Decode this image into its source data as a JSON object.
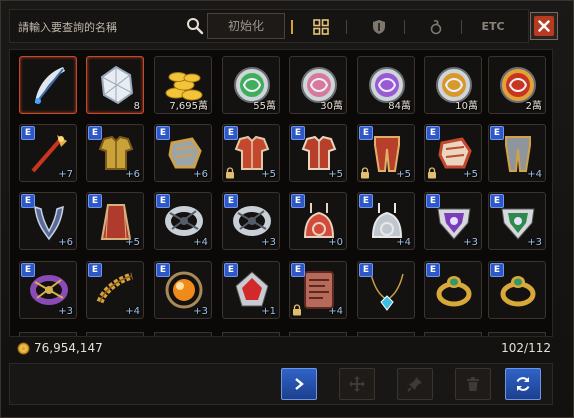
{
  "search": {
    "placeholder": "請輸入要查詢的名稱"
  },
  "toolbar": {
    "init_label": "初始化"
  },
  "tabs": [
    {
      "id": "all",
      "icon": "grid-icon",
      "active": true
    },
    {
      "id": "equip",
      "icon": "shield-icon",
      "active": false
    },
    {
      "id": "consumable",
      "icon": "potion-icon",
      "active": false
    },
    {
      "id": "etc",
      "label": "ETC",
      "active": false
    }
  ],
  "inventory": {
    "gold": "76,954,147",
    "capacity": "102/112",
    "slots": [
      {
        "name": "feather-quill",
        "qty": "",
        "enh": "",
        "e": false,
        "lock": false,
        "selected": true,
        "art": "feather",
        "c1": "#dfe6ee",
        "c2": "#3a6fb0"
      },
      {
        "name": "crystal-gem",
        "qty": "8",
        "enh": "",
        "e": false,
        "lock": false,
        "selected": true,
        "art": "crystal",
        "c1": "#e8edf4",
        "c2": "#9aa7b8"
      },
      {
        "name": "gold-coins",
        "qty": "7,695萬",
        "enh": "",
        "e": false,
        "lock": false,
        "selected": false,
        "art": "coins",
        "c1": "#f3c43a",
        "c2": "#a77a12"
      },
      {
        "name": "green-medal",
        "qty": "55萬",
        "enh": "",
        "e": false,
        "lock": false,
        "selected": false,
        "art": "medal",
        "c1": "#3fae5a",
        "c2": "#cfd6da"
      },
      {
        "name": "pink-medal",
        "qty": "30萬",
        "enh": "",
        "e": false,
        "lock": false,
        "selected": false,
        "art": "medal",
        "c1": "#d77a9a",
        "c2": "#cfd6da"
      },
      {
        "name": "purple-medal",
        "qty": "84萬",
        "enh": "",
        "e": false,
        "lock": false,
        "selected": false,
        "art": "medal",
        "c1": "#9a5ad6",
        "c2": "#cfd6da"
      },
      {
        "name": "gold-medal",
        "qty": "10萬",
        "enh": "",
        "e": false,
        "lock": false,
        "selected": false,
        "art": "medal",
        "c1": "#d79a2a",
        "c2": "#cfd6da"
      },
      {
        "name": "red-medal",
        "qty": "2萬",
        "enh": "",
        "e": false,
        "lock": false,
        "selected": false,
        "art": "medal",
        "c1": "#c8361e",
        "c2": "#e2a23a"
      },
      {
        "name": "red-staff",
        "qty": "",
        "enh": "+7",
        "e": true,
        "lock": false,
        "selected": false,
        "art": "staff",
        "c1": "#c8361e",
        "c2": "#e6b04a"
      },
      {
        "name": "gold-armor",
        "qty": "",
        "enh": "+6",
        "e": true,
        "lock": false,
        "selected": false,
        "art": "armor",
        "c1": "#caa23a",
        "c2": "#7a5a1a"
      },
      {
        "name": "gold-gauntlet",
        "qty": "",
        "enh": "+6",
        "e": true,
        "lock": false,
        "selected": false,
        "art": "gauntlet",
        "c1": "#cfa04a",
        "c2": "#9aa4ae"
      },
      {
        "name": "red-pauldron",
        "qty": "",
        "enh": "+5",
        "e": true,
        "lock": true,
        "selected": false,
        "art": "armor",
        "c1": "#c4482e",
        "c2": "#e0c9a8"
      },
      {
        "name": "red-chest",
        "qty": "",
        "enh": "+5",
        "e": true,
        "lock": false,
        "selected": false,
        "art": "armor",
        "c1": "#b8402a",
        "c2": "#e8d6c0"
      },
      {
        "name": "red-leggings",
        "qty": "",
        "enh": "+5",
        "e": true,
        "lock": true,
        "selected": false,
        "art": "legs",
        "c1": "#b8402a",
        "c2": "#e0b06a"
      },
      {
        "name": "red-glove",
        "qty": "",
        "enh": "+5",
        "e": true,
        "lock": true,
        "selected": false,
        "art": "gauntlet",
        "c1": "#c4482e",
        "c2": "#e8d6c0"
      },
      {
        "name": "silver-pants",
        "qty": "",
        "enh": "+4",
        "e": true,
        "lock": false,
        "selected": false,
        "art": "legs",
        "c1": "#8f959c",
        "c2": "#d0a24a"
      },
      {
        "name": "dark-necklace",
        "qty": "",
        "enh": "+6",
        "e": true,
        "lock": false,
        "selected": false,
        "art": "neck",
        "c1": "#5a6a9a",
        "c2": "#c8d0e0"
      },
      {
        "name": "red-cape",
        "qty": "",
        "enh": "+5",
        "e": true,
        "lock": false,
        "selected": false,
        "art": "cape",
        "c1": "#b03a2e",
        "c2": "#d8b07a"
      },
      {
        "name": "silver-bracer-a",
        "qty": "",
        "enh": "+4",
        "e": true,
        "lock": false,
        "selected": false,
        "art": "bracer",
        "c1": "#c9cfd6",
        "c2": "#555c66"
      },
      {
        "name": "silver-bracer-b",
        "qty": "",
        "enh": "+3",
        "e": true,
        "lock": false,
        "selected": false,
        "art": "bracer",
        "c1": "#c9cfd6",
        "c2": "#555c66"
      },
      {
        "name": "red-earring",
        "qty": "",
        "enh": "+0",
        "e": true,
        "lock": false,
        "selected": false,
        "art": "earring",
        "c1": "#d24a3a",
        "c2": "#e8d2c0"
      },
      {
        "name": "silver-earring",
        "qty": "",
        "enh": "+4",
        "e": true,
        "lock": false,
        "selected": false,
        "art": "earring",
        "c1": "#bfc6ce",
        "c2": "#e8e8e8"
      },
      {
        "name": "purple-amulet",
        "qty": "",
        "enh": "+3",
        "e": true,
        "lock": false,
        "selected": false,
        "art": "amulet",
        "c1": "#7a3fb8",
        "c2": "#d6d8de"
      },
      {
        "name": "green-amulet",
        "qty": "",
        "enh": "+3",
        "e": true,
        "lock": false,
        "selected": false,
        "art": "amulet",
        "c1": "#2e8a4a",
        "c2": "#d6d8de"
      },
      {
        "name": "purple-bracelet",
        "qty": "",
        "enh": "+3",
        "e": true,
        "lock": false,
        "selected": false,
        "art": "bracer",
        "c1": "#8a4ab8",
        "c2": "#d6b04a"
      },
      {
        "name": "gold-chain",
        "qty": "",
        "enh": "+4",
        "e": true,
        "lock": false,
        "selected": false,
        "art": "chain",
        "c1": "#d6a23a",
        "c2": "#8a5a1a"
      },
      {
        "name": "orange-orb",
        "qty": "",
        "enh": "+3",
        "e": true,
        "lock": false,
        "selected": false,
        "art": "orb",
        "c1": "#f08a1a",
        "c2": "#a88a5a"
      },
      {
        "name": "ruby-brooch",
        "qty": "",
        "enh": "+1",
        "e": true,
        "lock": false,
        "selected": false,
        "art": "brooch",
        "c1": "#d22a2a",
        "c2": "#c8ccd2"
      },
      {
        "name": "rune-tablet",
        "qty": "",
        "enh": "+4",
        "e": true,
        "lock": true,
        "selected": false,
        "art": "tablet",
        "c1": "#b86a5a",
        "c2": "#5a2a22"
      },
      {
        "name": "blue-pendant",
        "qty": "",
        "enh": "",
        "e": true,
        "lock": false,
        "selected": false,
        "art": "pendant",
        "c1": "#3ac0e8",
        "c2": "#c8a04a"
      },
      {
        "name": "emerald-ring-a",
        "qty": "",
        "enh": "",
        "e": true,
        "lock": false,
        "selected": false,
        "art": "ring",
        "c1": "#d8a83a",
        "c2": "#2e9a6a"
      },
      {
        "name": "emerald-ring-b",
        "qty": "",
        "enh": "",
        "e": true,
        "lock": false,
        "selected": false,
        "art": "ring",
        "c1": "#d8a83a",
        "c2": "#2e9a6a"
      }
    ]
  },
  "bottom_buttons": [
    {
      "name": "next-button",
      "icon": "chevron-right-icon",
      "blue": true
    },
    {
      "name": "move-button",
      "icon": "move-icon",
      "blue": false
    },
    {
      "name": "pin-button",
      "icon": "pin-icon",
      "blue": false
    },
    {
      "name": "delete-button",
      "icon": "trash-icon",
      "blue": false
    },
    {
      "name": "refresh-button",
      "icon": "refresh-icon",
      "blue": true
    }
  ]
}
